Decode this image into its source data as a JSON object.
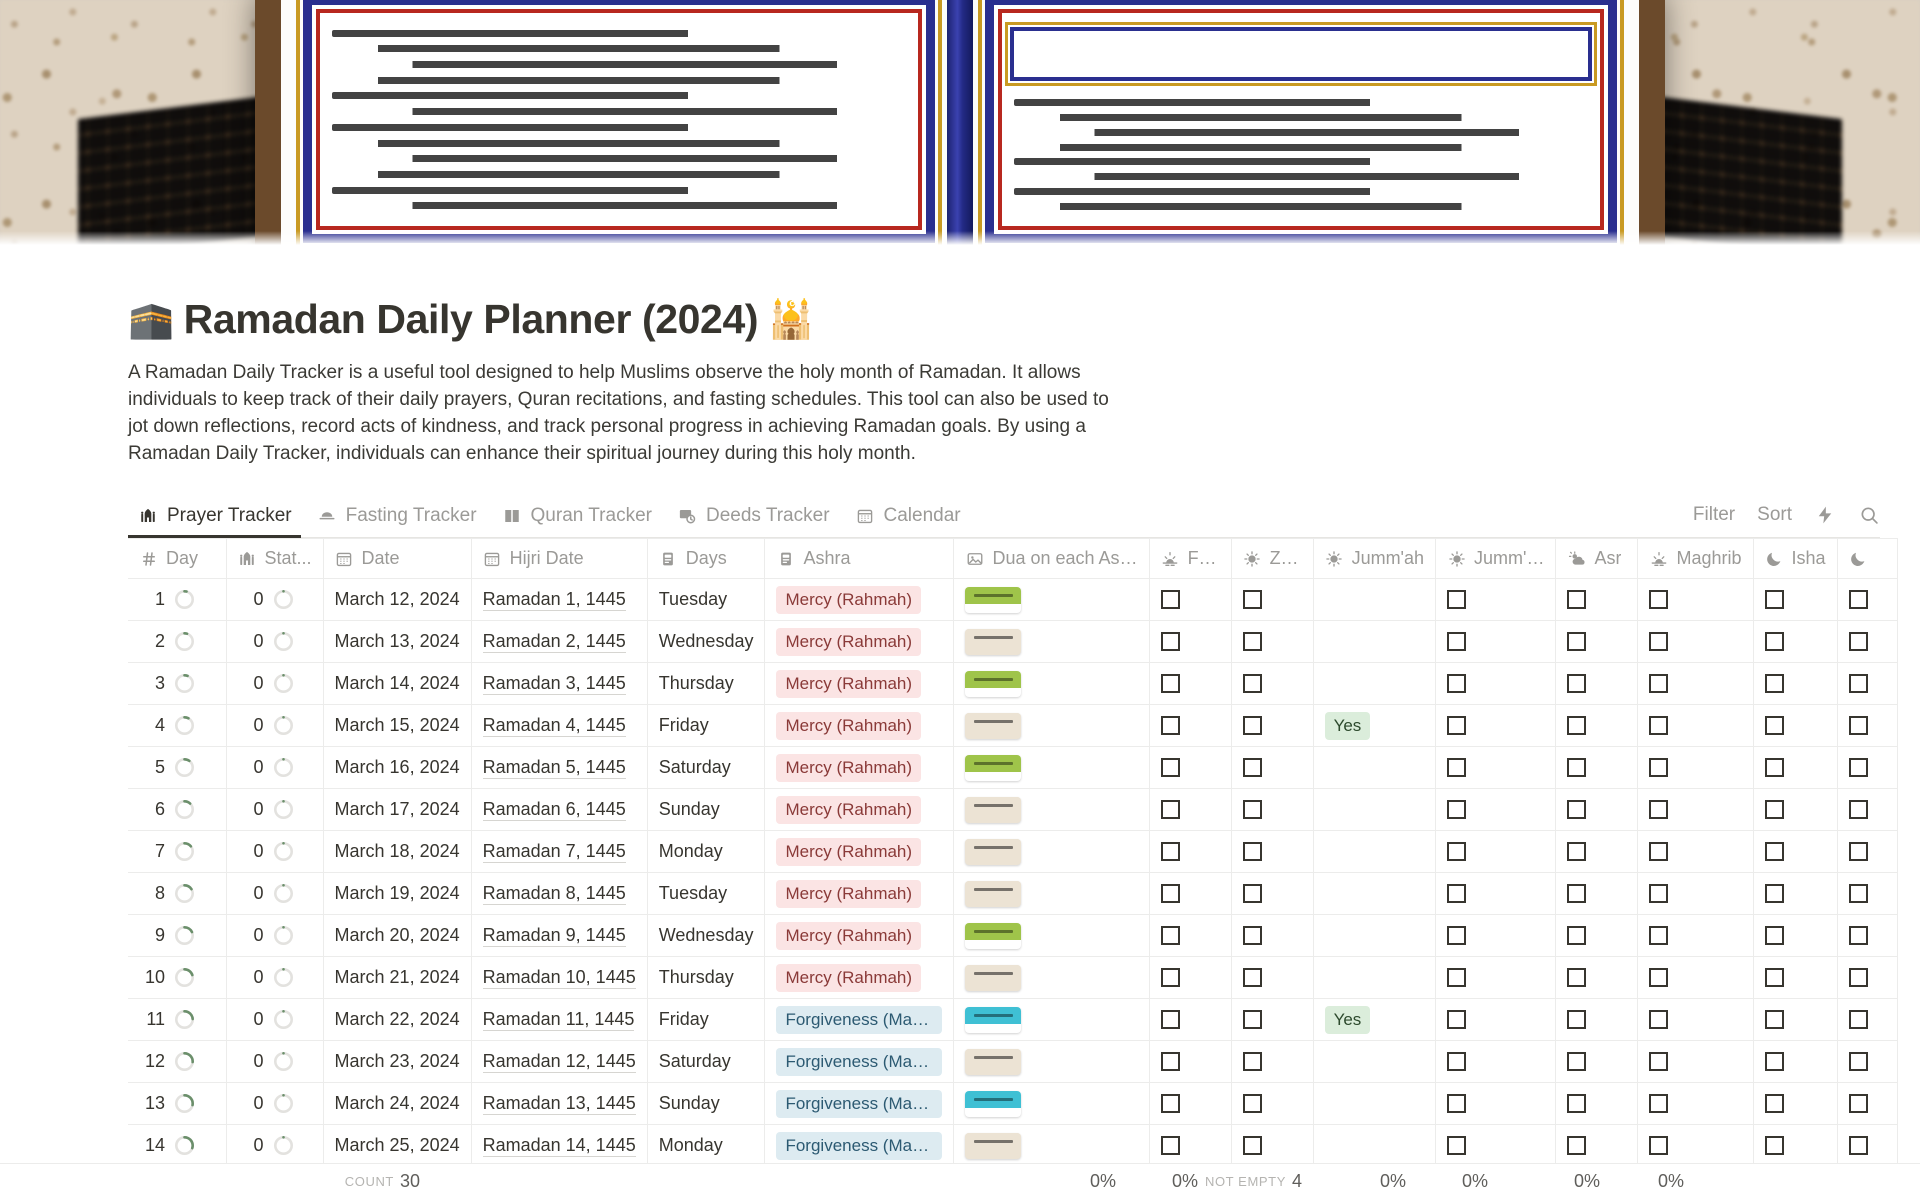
{
  "banner": {
    "alt": "open-quran-photo"
  },
  "header": {
    "title": "Ramadan Daily Planner (2024)",
    "emoji_left": "🕋",
    "emoji_right": "🕌",
    "description": "A Ramadan Daily Tracker is a useful tool designed to help Muslims observe the holy month of Ramadan. It allows individuals to keep track of their daily prayers, Quran recitations, and fasting schedules. This tool can also be used to jot down reflections, record acts of kindness, and track personal progress in achieving Ramadan goals. By using a Ramadan Daily Tracker, individuals can enhance their spiritual journey during this holy month."
  },
  "tabs": [
    {
      "label": "Prayer Tracker",
      "icon": "mosque-icon",
      "active": true
    },
    {
      "label": "Fasting Tracker",
      "icon": "food-icon",
      "active": false
    },
    {
      "label": "Quran Tracker",
      "icon": "book-icon",
      "active": false
    },
    {
      "label": "Deeds Tracker",
      "icon": "deeds-icon",
      "active": false
    },
    {
      "label": "Calendar",
      "icon": "calendar-icon",
      "active": false
    }
  ],
  "toolbar": {
    "filter_label": "Filter",
    "sort_label": "Sort",
    "automation_icon": "lightning-icon",
    "search_icon": "search-icon"
  },
  "table": {
    "columns": [
      {
        "key": "day",
        "label": "Day",
        "icon": "hash-icon",
        "cls": "c-day"
      },
      {
        "key": "status",
        "label": "Stat...",
        "icon": "mosque-icon",
        "cls": "c-stat"
      },
      {
        "key": "date",
        "label": "Date",
        "icon": "calendar-icon",
        "cls": "c-date"
      },
      {
        "key": "hijri",
        "label": "Hijri Date",
        "icon": "calendar-icon",
        "cls": "c-hijri"
      },
      {
        "key": "days",
        "label": "Days",
        "icon": "date-icon",
        "cls": "c-days"
      },
      {
        "key": "ashra",
        "label": "Ashra",
        "icon": "date-icon",
        "cls": "c-ashra"
      },
      {
        "key": "dua",
        "label": "Dua on each As…",
        "icon": "image-icon",
        "cls": "c-dua"
      },
      {
        "key": "fajr",
        "label": "F…",
        "icon": "sunrise-icon",
        "cls": "c-chk"
      },
      {
        "key": "zuhr",
        "label": "Z…",
        "icon": "sun-icon",
        "cls": "c-chk"
      },
      {
        "key": "jummah",
        "label": "Jumm'ah",
        "icon": "sun-icon",
        "cls": "c-jum"
      },
      {
        "key": "jummah2",
        "label": "Jumm'…",
        "icon": "sun-icon",
        "cls": "c-jum2"
      },
      {
        "key": "asr",
        "label": "Asr",
        "icon": "sun-cloud-icon",
        "cls": "c-asr"
      },
      {
        "key": "maghrib",
        "label": "Maghrib",
        "icon": "sunset-icon",
        "cls": "c-mag"
      },
      {
        "key": "isha",
        "label": "Isha",
        "icon": "moon-icon",
        "cls": "c-isha"
      },
      {
        "key": "tarawih",
        "label": "",
        "icon": "moon-icon",
        "cls": "c-tar"
      }
    ],
    "rows": [
      {
        "day": "1",
        "status": "0",
        "progress": 4,
        "date": "March 12, 2024",
        "hijri": "Ramadan 1, 1445",
        "days": "Tuesday",
        "ashra": "Mercy (Rahmah)",
        "ashra_type": "rahmah",
        "thumb": "green",
        "jummah": ""
      },
      {
        "day": "2",
        "status": "0",
        "progress": 5,
        "date": "March 13, 2024",
        "hijri": "Ramadan 2, 1445",
        "days": "Wednesday",
        "ashra": "Mercy (Rahmah)",
        "ashra_type": "rahmah",
        "thumb": "beige",
        "jummah": ""
      },
      {
        "day": "3",
        "status": "0",
        "progress": 6,
        "date": "March 14, 2024",
        "hijri": "Ramadan 3, 1445",
        "days": "Thursday",
        "ashra": "Mercy (Rahmah)",
        "ashra_type": "rahmah",
        "thumb": "green",
        "jummah": ""
      },
      {
        "day": "4",
        "status": "0",
        "progress": 8,
        "date": "March 15, 2024",
        "hijri": "Ramadan 4, 1445",
        "days": "Friday",
        "ashra": "Mercy (Rahmah)",
        "ashra_type": "rahmah",
        "thumb": "beige",
        "jummah": "Yes"
      },
      {
        "day": "5",
        "status": "0",
        "progress": 10,
        "date": "March 16, 2024",
        "hijri": "Ramadan 5, 1445",
        "days": "Saturday",
        "ashra": "Mercy (Rahmah)",
        "ashra_type": "rahmah",
        "thumb": "green",
        "jummah": ""
      },
      {
        "day": "6",
        "status": "0",
        "progress": 12,
        "date": "March 17, 2024",
        "hijri": "Ramadan 6, 1445",
        "days": "Sunday",
        "ashra": "Mercy (Rahmah)",
        "ashra_type": "rahmah",
        "thumb": "beige",
        "jummah": ""
      },
      {
        "day": "7",
        "status": "0",
        "progress": 14,
        "date": "March 18, 2024",
        "hijri": "Ramadan 7, 1445",
        "days": "Monday",
        "ashra": "Mercy (Rahmah)",
        "ashra_type": "rahmah",
        "thumb": "beige",
        "jummah": ""
      },
      {
        "day": "8",
        "status": "0",
        "progress": 16,
        "date": "March 19, 2024",
        "hijri": "Ramadan 8, 1445",
        "days": "Tuesday",
        "ashra": "Mercy (Rahmah)",
        "ashra_type": "rahmah",
        "thumb": "beige",
        "jummah": ""
      },
      {
        "day": "9",
        "status": "0",
        "progress": 18,
        "date": "March 20, 2024",
        "hijri": "Ramadan 9, 1445",
        "days": "Wednesday",
        "ashra": "Mercy (Rahmah)",
        "ashra_type": "rahmah",
        "thumb": "green",
        "jummah": ""
      },
      {
        "day": "10",
        "status": "0",
        "progress": 20,
        "date": "March 21, 2024",
        "hijri": "Ramadan 10, 1445",
        "days": "Thursday",
        "ashra": "Mercy (Rahmah)",
        "ashra_type": "rahmah",
        "thumb": "beige",
        "jummah": ""
      },
      {
        "day": "11",
        "status": "0",
        "progress": 24,
        "date": "March 22, 2024",
        "hijri": "Ramadan 11, 1445",
        "days": "Friday",
        "ashra": "Forgiveness (Magfir…",
        "ashra_type": "magfirah",
        "thumb": "cyan",
        "jummah": "Yes"
      },
      {
        "day": "12",
        "status": "0",
        "progress": 26,
        "date": "March 23, 2024",
        "hijri": "Ramadan 12, 1445",
        "days": "Saturday",
        "ashra": "Forgiveness (Magfir…",
        "ashra_type": "magfirah",
        "thumb": "beige",
        "jummah": ""
      },
      {
        "day": "13",
        "status": "0",
        "progress": 28,
        "date": "March 24, 2024",
        "hijri": "Ramadan 13, 1445",
        "days": "Sunday",
        "ashra": "Forgiveness (Magfir…",
        "ashra_type": "magfirah",
        "thumb": "cyan",
        "jummah": ""
      },
      {
        "day": "14",
        "status": "0",
        "progress": 30,
        "date": "March 25, 2024",
        "hijri": "Ramadan 14, 1445",
        "days": "Monday",
        "ashra": "Forgiveness (Magfir…",
        "ashra_type": "magfirah",
        "thumb": "beige",
        "jummah": ""
      }
    ],
    "summary": [
      {
        "cls": "c-day",
        "label": "",
        "value": ""
      },
      {
        "cls": "c-stat",
        "label": "",
        "value": ""
      },
      {
        "cls": "c-date",
        "label": "COUNT",
        "value": "30"
      },
      {
        "cls": "c-hijri",
        "label": "",
        "value": ""
      },
      {
        "cls": "c-days",
        "label": "",
        "value": ""
      },
      {
        "cls": "c-ashra",
        "label": "",
        "value": ""
      },
      {
        "cls": "c-dua",
        "label": "",
        "value": ""
      },
      {
        "cls": "c-chk",
        "label": "",
        "value": "0%"
      },
      {
        "cls": "c-chk",
        "label": "",
        "value": "0%"
      },
      {
        "cls": "c-jum",
        "label": "NOT EMPTY",
        "value": "4"
      },
      {
        "cls": "c-jum2",
        "label": "",
        "value": "0%"
      },
      {
        "cls": "c-asr",
        "label": "",
        "value": "0%"
      },
      {
        "cls": "c-mag",
        "label": "",
        "value": "0%"
      },
      {
        "cls": "c-isha",
        "label": "",
        "value": "0%"
      },
      {
        "cls": "c-tar",
        "label": "",
        "value": ""
      }
    ]
  },
  "colors": {
    "accent_green": "#6b8f6b",
    "rahmah_bg": "#fbe4e4",
    "magfirah_bg": "#ddebf1",
    "yes_bg": "#dbeddb",
    "text": "#37352f",
    "muted": "#9b9a97"
  }
}
